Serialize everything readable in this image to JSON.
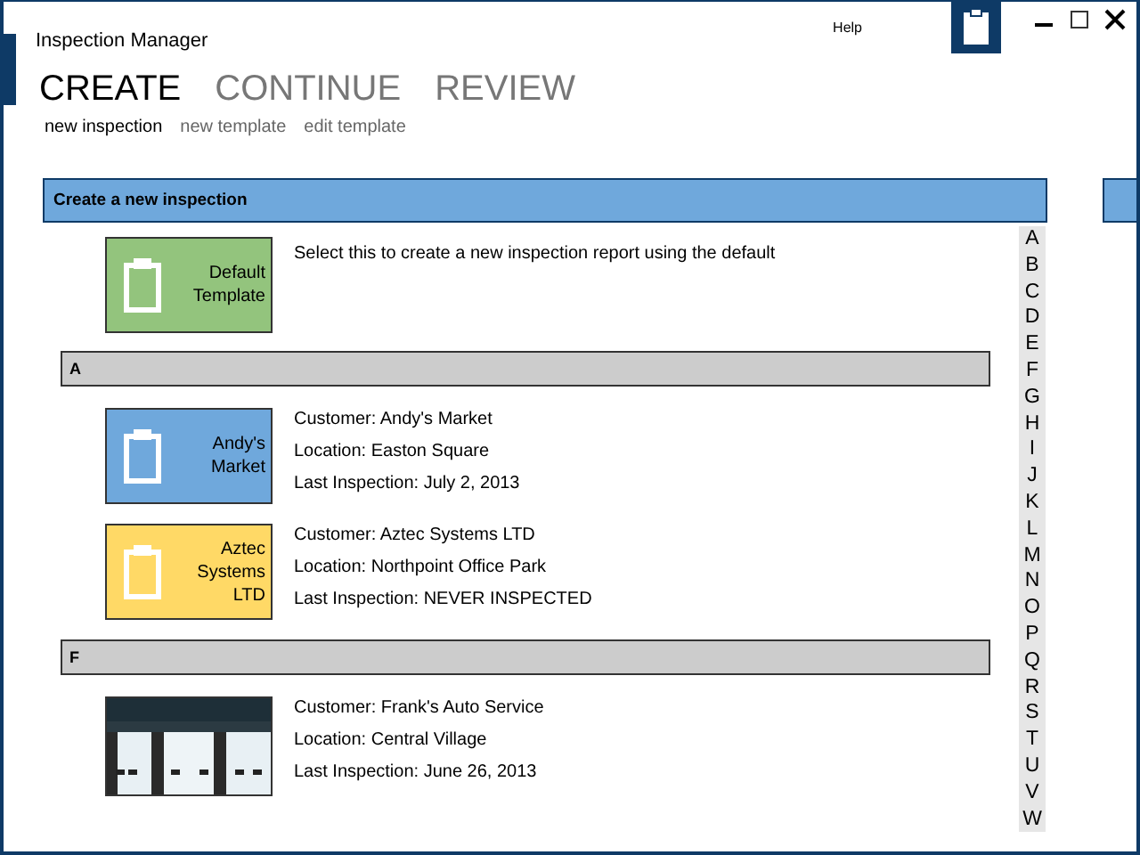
{
  "window": {
    "title": "Inspection Manager",
    "help": "Help"
  },
  "tabs": [
    {
      "label": "CREATE",
      "selected": true
    },
    {
      "label": "CONTINUE",
      "selected": false
    },
    {
      "label": "REVIEW",
      "selected": false
    }
  ],
  "subtabs": [
    {
      "label": "new inspection",
      "selected": true
    },
    {
      "label": "new template",
      "selected": false
    },
    {
      "label": "edit template",
      "selected": false
    }
  ],
  "section": {
    "title": "Create a new inspection"
  },
  "default_template": {
    "label": "Default Template",
    "color": "#93c47d",
    "description": "Select this to create a new inspection report using the default"
  },
  "groups": [
    {
      "letter": "A",
      "items": [
        {
          "kind": "template",
          "label": "Andy's Market",
          "color": "#6fa8dc",
          "customer": "Customer: Andy's Market",
          "location": "Location: Easton Square",
          "last_inspection": "Last Inspection: July 2, 2013"
        },
        {
          "kind": "template",
          "label": "Aztec Systems LTD",
          "color": "#ffd966",
          "customer": "Customer: Aztec Systems LTD",
          "location": "Location: Northpoint Office Park",
          "last_inspection": "Last Inspection: NEVER INSPECTED"
        }
      ]
    },
    {
      "letter": "F",
      "items": [
        {
          "kind": "picture",
          "customer": "Customer: Frank's Auto Service",
          "location": "Location: Central Village",
          "last_inspection": "Last Inspection: June 26, 2013"
        }
      ]
    }
  ],
  "index": [
    "A",
    "B",
    "C",
    "D",
    "E",
    "F",
    "G",
    "H",
    "I",
    "J",
    "K",
    "L",
    "M",
    "N",
    "O",
    "P",
    "Q",
    "R",
    "S",
    "T",
    "U",
    "V",
    "W"
  ]
}
